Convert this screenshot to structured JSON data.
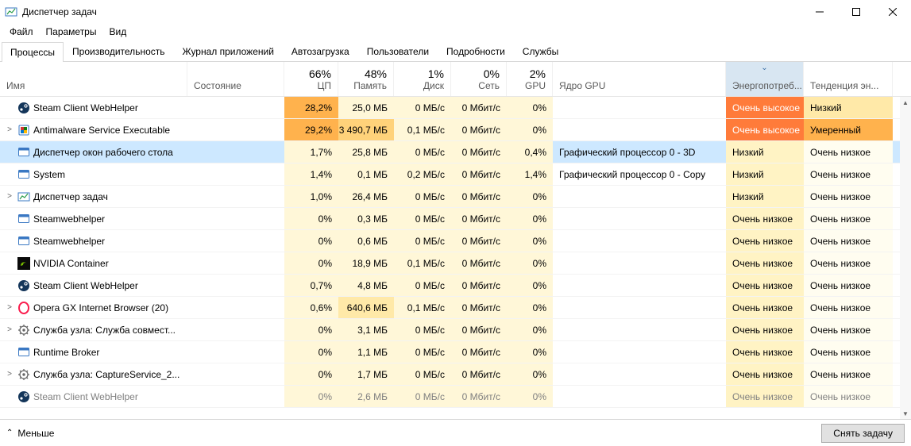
{
  "window": {
    "title": "Диспетчер задач"
  },
  "menu": {
    "file": "Файл",
    "options": "Параметры",
    "view": "Вид"
  },
  "tabs": {
    "processes": "Процессы",
    "performance": "Производительность",
    "apphistory": "Журнал приложений",
    "startup": "Автозагрузка",
    "users": "Пользователи",
    "details": "Подробности",
    "services": "Службы"
  },
  "columns": {
    "name": "Имя",
    "status": "Состояние",
    "cpu": "ЦП",
    "cpu_pct": "66%",
    "mem": "Память",
    "mem_pct": "48%",
    "disk": "Диск",
    "disk_pct": "1%",
    "net": "Сеть",
    "net_pct": "0%",
    "gpu": "GPU",
    "gpu_pct": "2%",
    "gpueng": "Ядро GPU",
    "energy": "Энергопотреб...",
    "trend": "Тенденция эн..."
  },
  "footer": {
    "less": "Меньше",
    "end_task": "Снять задачу"
  },
  "rows": [
    {
      "expand": false,
      "icon": "steam",
      "name": "Steam Client WebHelper",
      "cpu": "28,2%",
      "cpu_h": 4,
      "mem": "25,0 МБ",
      "mem_h": 1,
      "disk": "0 МБ/с",
      "disk_h": 1,
      "net": "0 Мбит/с",
      "net_h": 1,
      "gpu": "0%",
      "gpu_h": 1,
      "gpueng": "",
      "energy": "Очень высокое",
      "energy_cls": "e-veryhigh",
      "trend": "Низкий",
      "trend_cls": "h2"
    },
    {
      "expand": true,
      "icon": "shield",
      "name": "Antimalware Service Executable",
      "cpu": "29,2%",
      "cpu_h": 4,
      "mem": "3 490,7 МБ",
      "mem_h": 3,
      "disk": "0,1 МБ/с",
      "disk_h": 1,
      "net": "0 Мбит/с",
      "net_h": 1,
      "gpu": "0%",
      "gpu_h": 1,
      "gpueng": "",
      "energy": "Очень высокое",
      "energy_cls": "e-veryhigh",
      "trend": "Умеренный",
      "trend_cls": "h4",
      "selected": false
    },
    {
      "expand": false,
      "icon": "dwm",
      "name": "Диспетчер окон рабочего стола",
      "cpu": "1,7%",
      "cpu_h": 1,
      "mem": "25,8 МБ",
      "mem_h": 1,
      "disk": "0 МБ/с",
      "disk_h": 1,
      "net": "0 Мбит/с",
      "net_h": 1,
      "gpu": "0,4%",
      "gpu_h": 1,
      "gpueng": "Графический процессор 0 - 3D",
      "energy": "Низкий",
      "energy_cls": "e-lowtxt",
      "trend": "Очень низкое",
      "trend_cls": "e-verylow2",
      "selrow": true
    },
    {
      "expand": false,
      "icon": "sys",
      "name": "System",
      "cpu": "1,4%",
      "cpu_h": 1,
      "mem": "0,1 МБ",
      "mem_h": 1,
      "disk": "0,2 МБ/с",
      "disk_h": 1,
      "net": "0 Мбит/с",
      "net_h": 1,
      "gpu": "1,4%",
      "gpu_h": 1,
      "gpueng": "Графический процессор 0 - Copy",
      "energy": "Низкий",
      "energy_cls": "e-lowtxt",
      "trend": "Очень низкое",
      "trend_cls": "e-verylow2"
    },
    {
      "expand": true,
      "icon": "tm",
      "name": "Диспетчер задач",
      "cpu": "1,0%",
      "cpu_h": 1,
      "mem": "26,4 МБ",
      "mem_h": 1,
      "disk": "0 МБ/с",
      "disk_h": 1,
      "net": "0 Мбит/с",
      "net_h": 1,
      "gpu": "0%",
      "gpu_h": 1,
      "gpueng": "",
      "energy": "Низкий",
      "energy_cls": "e-lowtxt",
      "trend": "Очень низкое",
      "trend_cls": "e-verylow2"
    },
    {
      "expand": false,
      "icon": "exe",
      "name": "Steamwebhelper",
      "cpu": "0%",
      "cpu_h": 1,
      "mem": "0,3 МБ",
      "mem_h": 1,
      "disk": "0 МБ/с",
      "disk_h": 1,
      "net": "0 Мбит/с",
      "net_h": 1,
      "gpu": "0%",
      "gpu_h": 1,
      "gpueng": "",
      "energy": "Очень низкое",
      "energy_cls": "e-verylow",
      "trend": "Очень низкое",
      "trend_cls": "e-verylow2"
    },
    {
      "expand": false,
      "icon": "exe",
      "name": "Steamwebhelper",
      "cpu": "0%",
      "cpu_h": 1,
      "mem": "0,6 МБ",
      "mem_h": 1,
      "disk": "0 МБ/с",
      "disk_h": 1,
      "net": "0 Мбит/с",
      "net_h": 1,
      "gpu": "0%",
      "gpu_h": 1,
      "gpueng": "",
      "energy": "Очень низкое",
      "energy_cls": "e-verylow",
      "trend": "Очень низкое",
      "trend_cls": "e-verylow2"
    },
    {
      "expand": false,
      "icon": "nvidia",
      "name": "NVIDIA Container",
      "cpu": "0%",
      "cpu_h": 1,
      "mem": "18,9 МБ",
      "mem_h": 1,
      "disk": "0,1 МБ/с",
      "disk_h": 1,
      "net": "0 Мбит/с",
      "net_h": 1,
      "gpu": "0%",
      "gpu_h": 1,
      "gpueng": "",
      "energy": "Очень низкое",
      "energy_cls": "e-verylow",
      "trend": "Очень низкое",
      "trend_cls": "e-verylow2"
    },
    {
      "expand": false,
      "icon": "steam",
      "name": "Steam Client WebHelper",
      "cpu": "0,7%",
      "cpu_h": 1,
      "mem": "4,8 МБ",
      "mem_h": 1,
      "disk": "0 МБ/с",
      "disk_h": 1,
      "net": "0 Мбит/с",
      "net_h": 1,
      "gpu": "0%",
      "gpu_h": 1,
      "gpueng": "",
      "energy": "Очень низкое",
      "energy_cls": "e-verylow",
      "trend": "Очень низкое",
      "trend_cls": "e-verylow2"
    },
    {
      "expand": true,
      "icon": "opera",
      "name": "Opera GX Internet Browser (20)",
      "cpu": "0,6%",
      "cpu_h": 1,
      "mem": "640,6 МБ",
      "mem_h": 2,
      "disk": "0,1 МБ/с",
      "disk_h": 1,
      "net": "0 Мбит/с",
      "net_h": 1,
      "gpu": "0%",
      "gpu_h": 1,
      "gpueng": "",
      "energy": "Очень низкое",
      "energy_cls": "e-verylow",
      "trend": "Очень низкое",
      "trend_cls": "e-verylow2"
    },
    {
      "expand": true,
      "icon": "svc",
      "name": "Служба узла: Служба совмест...",
      "cpu": "0%",
      "cpu_h": 1,
      "mem": "3,1 МБ",
      "mem_h": 1,
      "disk": "0 МБ/с",
      "disk_h": 1,
      "net": "0 Мбит/с",
      "net_h": 1,
      "gpu": "0%",
      "gpu_h": 1,
      "gpueng": "",
      "energy": "Очень низкое",
      "energy_cls": "e-verylow",
      "trend": "Очень низкое",
      "trend_cls": "e-verylow2"
    },
    {
      "expand": false,
      "icon": "exe",
      "name": "Runtime Broker",
      "cpu": "0%",
      "cpu_h": 1,
      "mem": "1,1 МБ",
      "mem_h": 1,
      "disk": "0 МБ/с",
      "disk_h": 1,
      "net": "0 Мбит/с",
      "net_h": 1,
      "gpu": "0%",
      "gpu_h": 1,
      "gpueng": "",
      "energy": "Очень низкое",
      "energy_cls": "e-verylow",
      "trend": "Очень низкое",
      "trend_cls": "e-verylow2"
    },
    {
      "expand": true,
      "icon": "svc",
      "name": "Служба узла: CaptureService_2...",
      "cpu": "0%",
      "cpu_h": 1,
      "mem": "1,7 МБ",
      "mem_h": 1,
      "disk": "0 МБ/с",
      "disk_h": 1,
      "net": "0 Мбит/с",
      "net_h": 1,
      "gpu": "0%",
      "gpu_h": 1,
      "gpueng": "",
      "energy": "Очень низкое",
      "energy_cls": "e-verylow",
      "trend": "Очень низкое",
      "trend_cls": "e-verylow2"
    },
    {
      "expand": false,
      "icon": "steam",
      "name": "Steam Client WebHelper",
      "cpu": "0%",
      "cpu_h": 1,
      "mem": "2,6 МБ",
      "mem_h": 1,
      "disk": "0 МБ/с",
      "disk_h": 1,
      "net": "0 Мбит/с",
      "net_h": 1,
      "gpu": "0%",
      "gpu_h": 1,
      "gpueng": "",
      "energy": "Очень низкое",
      "energy_cls": "e-verylow",
      "trend": "Очень низкое",
      "trend_cls": "e-verylow2",
      "inactive": true
    }
  ]
}
